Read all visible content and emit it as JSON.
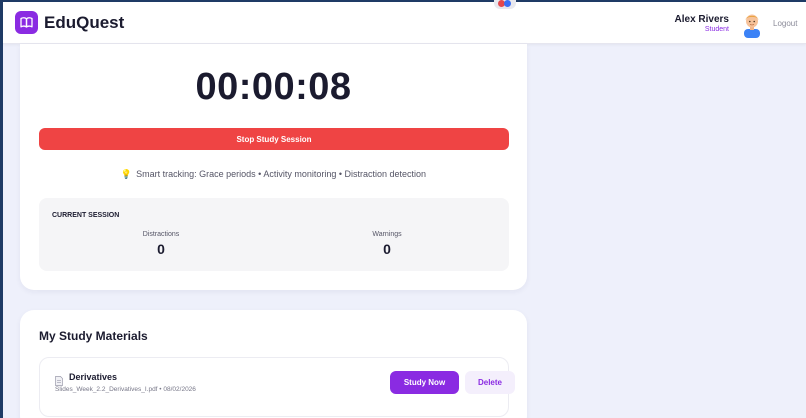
{
  "app": {
    "brand": "EduQuest"
  },
  "user": {
    "name": "Alex Rivers",
    "role": "Student",
    "logout_label": "Logout"
  },
  "timer": {
    "display": "00:00:08",
    "stop_label": "Stop Study Session",
    "tracking_note": "Smart tracking: Grace periods • Activity monitoring • Distraction detection"
  },
  "session": {
    "title": "CURRENT SESSION",
    "stats": [
      {
        "label": "Distractions",
        "value": "0"
      },
      {
        "label": "Warnings",
        "value": "0"
      }
    ]
  },
  "materials": {
    "title": "My Study Materials",
    "items": [
      {
        "name": "Derivatives",
        "meta": "Slides_Week_2.2_Derivatives_I.pdf • 08/02/2026",
        "study_label": "Study Now",
        "delete_label": "Delete"
      }
    ]
  },
  "colors": {
    "accent": "#8a2be2",
    "danger": "#ef4444"
  },
  "icons": {
    "logo": "book-icon",
    "tip": "lightbulb-icon",
    "file": "document-icon"
  }
}
